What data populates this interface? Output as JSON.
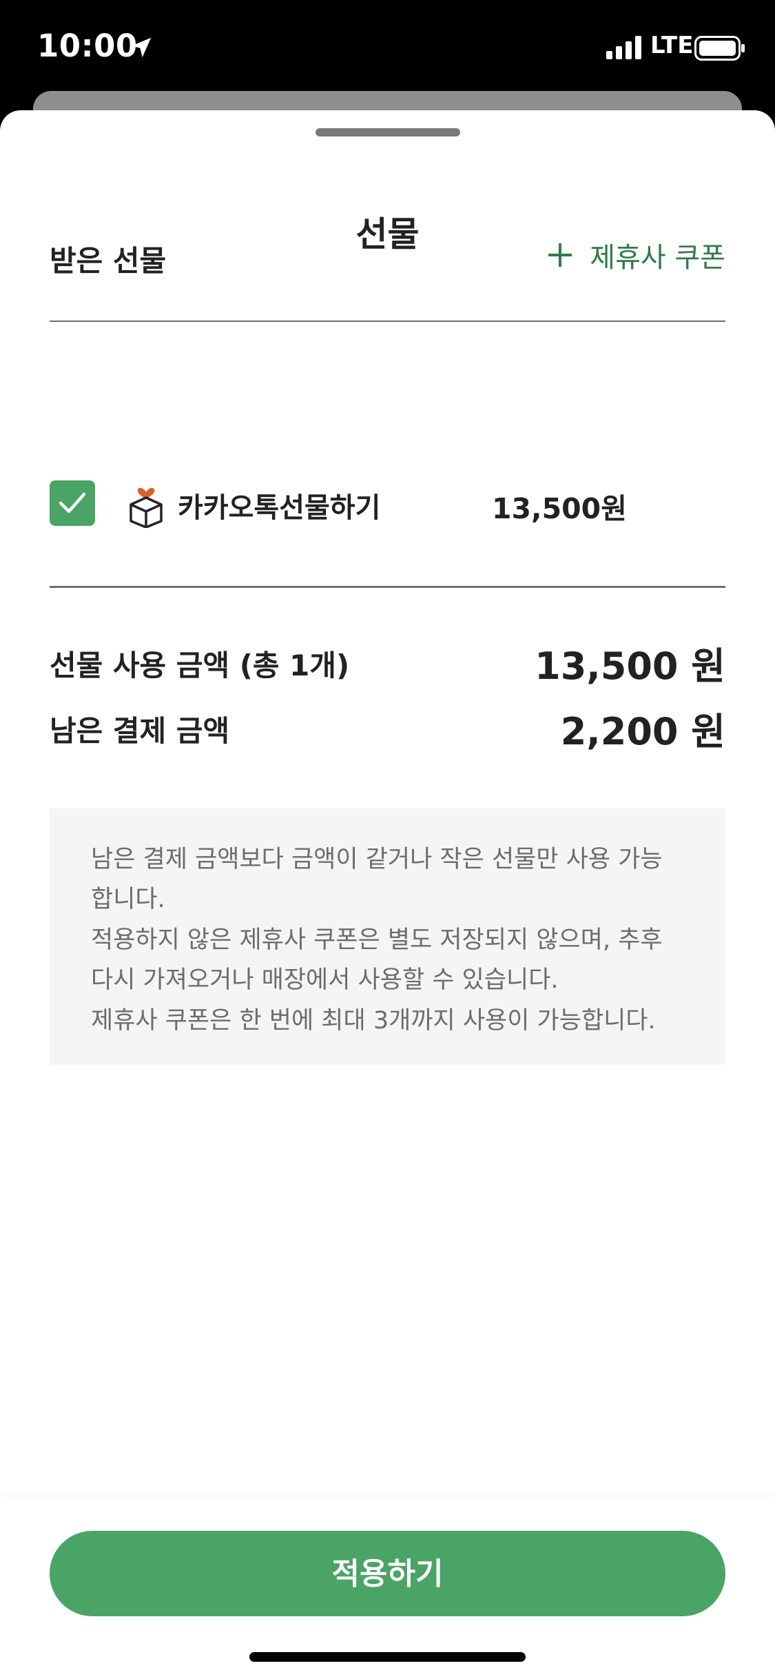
{
  "status_bar": {
    "time": "10:00",
    "network": "LTE",
    "icons": [
      "location-arrow-icon",
      "signal-bars-icon",
      "battery-icon"
    ]
  },
  "sheet": {
    "title": "선물"
  },
  "received_gifts": {
    "section_title": "받은 선물",
    "add_coupon_label": "제휴사 쿠폰",
    "items": [
      {
        "checked": true,
        "icon": "gift-box-icon",
        "name": "카카오톡선물하기",
        "amount": "13,500원"
      }
    ]
  },
  "summary": {
    "used_label": "선물 사용 금액 (총 1개)",
    "used_value": "13,500 원",
    "remaining_label": "남은 결제 금액",
    "remaining_value": "2,200 원"
  },
  "notice": {
    "lines": [
      "남은 결제 금액보다 금액이 같거나 작은 선물만 사용 가능",
      "합니다.",
      "적용하지 않은 제휴사 쿠폰은 별도 저장되지 않으며, 추후",
      "다시 가져오거나 매장에서 사용할 수 있습니다.",
      "제휴사 쿠폰은 한 번에 최대 3개까지 사용이 가능합니다."
    ]
  },
  "footer": {
    "apply_label": "적용하기"
  },
  "colors": {
    "accent_green": "#4aa466",
    "link_green": "#2f7a48",
    "text": "#222222",
    "notice_bg": "#f5f5f5"
  }
}
